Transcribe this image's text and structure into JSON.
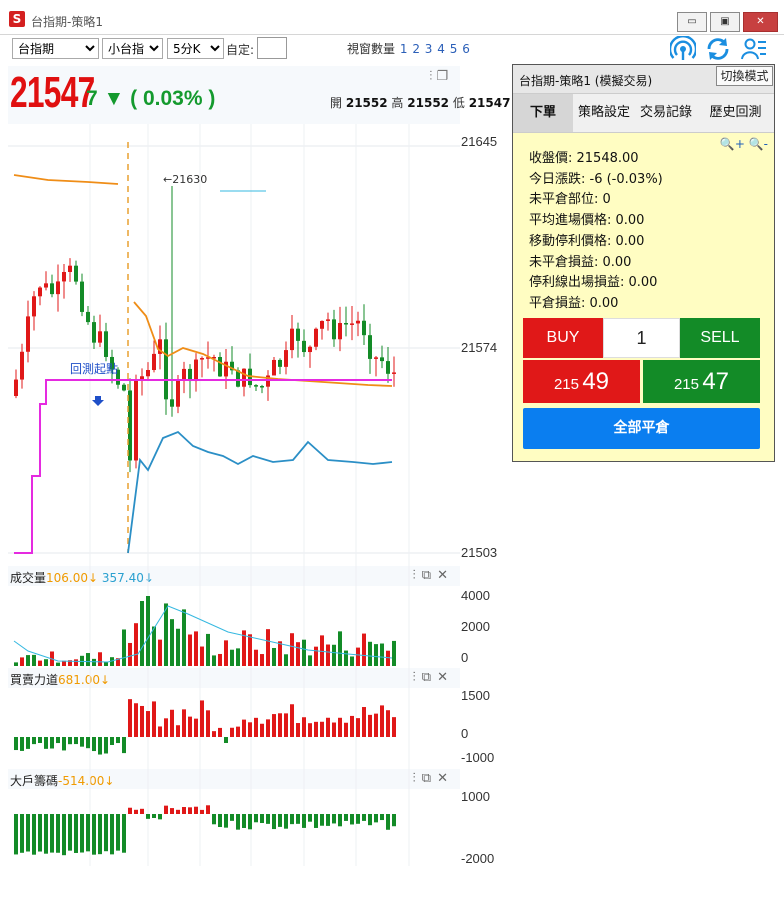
{
  "window": {
    "app_icon": "S",
    "title": "台指期-策略1",
    "minimize_icon": "minimize-icon",
    "restore_icon": "restore-icon",
    "close_icon": "close-icon"
  },
  "toolbar": {
    "symbol_select": "台指期",
    "sub_symbol_select": "小台指",
    "period_select": "5分K",
    "custom_label": "自定:",
    "custom_value": "",
    "window_count_label": "視窗數量",
    "window_counts": [
      "1",
      "2",
      "3",
      "4",
      "5",
      "6"
    ],
    "icons": [
      "signal-icon",
      "refresh-icon",
      "user-list-icon"
    ]
  },
  "quote": {
    "last_price": "21547",
    "change": "7 ▼ ( 0.03% )",
    "open_label": "開",
    "open": "21552",
    "high_label": "高",
    "high": "21552",
    "low_label": "低",
    "low": "21547",
    "header_icons": [
      "settings-sliders-icon",
      "copy-icon"
    ]
  },
  "main_chart": {
    "y_ticks": [
      "21645",
      "21574",
      "21503"
    ],
    "annotation_high": "←21630",
    "backtest_label": "回測起點",
    "colors": {
      "up": "#e01818",
      "down": "#138b27",
      "ma_orange": "#ef8d17",
      "ma_blue": "#2b8fc6",
      "cost_line": "#e52ae0"
    }
  },
  "panels": {
    "volume": {
      "label": "成交量",
      "value1": "106.00↓",
      "value2": "357.40↓",
      "y_ticks": [
        "4000",
        "2000",
        "0"
      ]
    },
    "force": {
      "label": "買賣力道",
      "value1": "681.00↓",
      "y_ticks": [
        "1500",
        "0",
        "-1000"
      ]
    },
    "chips": {
      "label": "大戶籌碼",
      "value1": "-514.00↓",
      "y_ticks": [
        "1000",
        "-2000"
      ]
    },
    "icons": [
      "settings-sliders-icon",
      "popout-icon",
      "close-icon"
    ]
  },
  "side_panel": {
    "title": "台指期-策略1 (模擬交易)",
    "switch_mode": "切換模式",
    "tabs": [
      "下單",
      "策略設定",
      "交易記錄",
      "歷史回測"
    ],
    "active_tab": "下單",
    "zoom_in": "+",
    "zoom_out": "-",
    "info": [
      "收盤價: 21548.00",
      "今日漲跌: -6 (-0.03%)",
      "未平倉部位: 0",
      "平均進場價格: 0.00",
      "移動停利價格: 0.00",
      "未平倉損益: 0.00",
      "停利線出場損益: 0.00",
      "平倉損益: 0.00"
    ],
    "buy_label": "BUY",
    "sell_label": "SELL",
    "quantity": "1",
    "buy_price_prefix": "215",
    "buy_price_main": "49",
    "sell_price_prefix": "215",
    "sell_price_main": "47",
    "close_all": "全部平倉"
  }
}
